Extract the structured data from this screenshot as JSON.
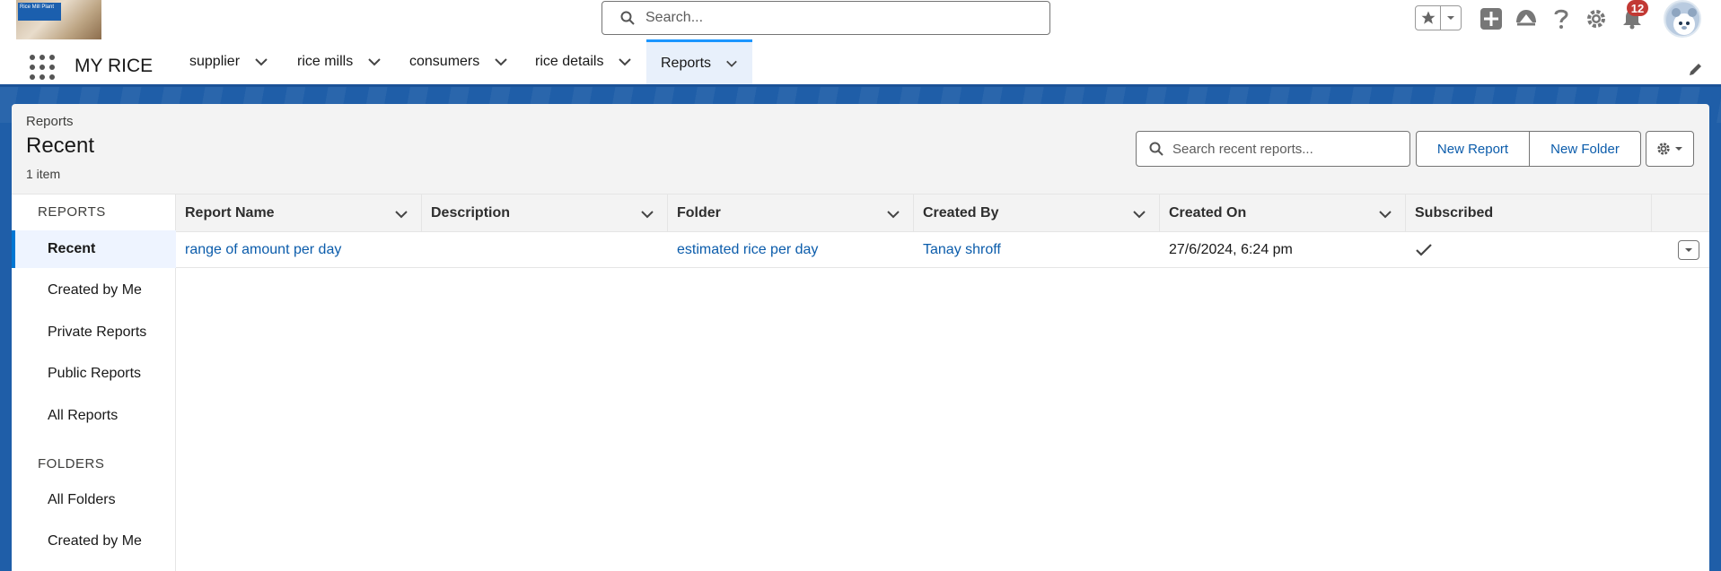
{
  "header": {
    "logo_text": "Rice Mill Plant",
    "search_placeholder": "Search...",
    "notification_count": "12",
    "icons": [
      "star-icon",
      "chevron-down-icon",
      "plus-icon",
      "trailhead-icon",
      "help-icon",
      "gear-icon",
      "bell-icon",
      "avatar"
    ]
  },
  "nav": {
    "app_name": "MY RICE",
    "tabs": [
      {
        "label": "supplier"
      },
      {
        "label": "rice mills"
      },
      {
        "label": "consumers"
      },
      {
        "label": "rice details"
      },
      {
        "label": "Reports"
      }
    ],
    "active_tab": "Reports"
  },
  "page": {
    "eyebrow": "Reports",
    "title": "Recent",
    "count": "1 item",
    "search_placeholder": "Search recent reports...",
    "new_report_label": "New Report",
    "new_folder_label": "New Folder"
  },
  "sidebar": {
    "reports_heading": "REPORTS",
    "report_items": [
      {
        "label": "Recent"
      },
      {
        "label": "Created by Me"
      },
      {
        "label": "Private Reports"
      },
      {
        "label": "Public Reports"
      },
      {
        "label": "All Reports"
      }
    ],
    "folders_heading": "FOLDERS",
    "folder_items": [
      {
        "label": "All Folders"
      },
      {
        "label": "Created by Me"
      }
    ]
  },
  "table": {
    "columns": [
      "Report Name",
      "Description",
      "Folder",
      "Created By",
      "Created On",
      "Subscribed"
    ],
    "rows": [
      {
        "report_name": "range of amount per day",
        "description": "",
        "folder": "estimated rice per day",
        "created_by": "Tanay shroff",
        "created_on": "27/6/2024, 6:24 pm",
        "subscribed": "✓"
      }
    ]
  },
  "colors": {
    "brand_blue": "#1f5ea8",
    "link": "#0b5cab",
    "active_accent": "#0176d3",
    "badge": "#c23934"
  }
}
